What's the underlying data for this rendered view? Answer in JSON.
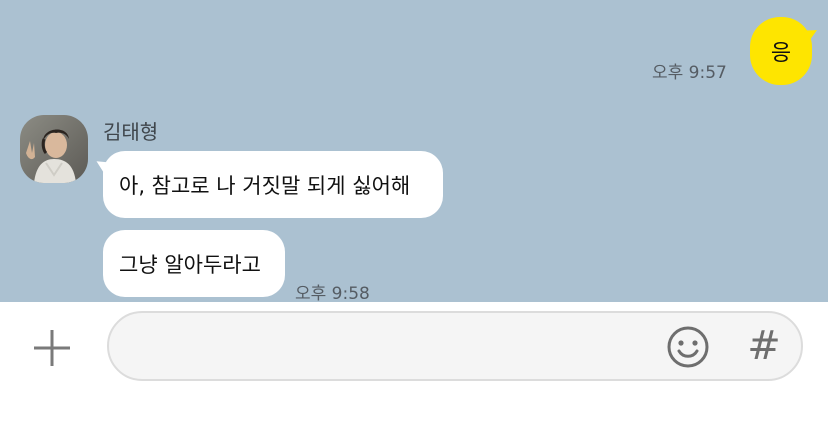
{
  "messages": {
    "mine": {
      "text": "응",
      "time": "오후 9:57"
    },
    "theirs": {
      "sender": "김태형",
      "bubbles": [
        "아, 참고로 나 거짓말 되게 싫어해",
        "그냥 알아두라고"
      ],
      "time": "오후 9:58"
    }
  },
  "input_bar": {
    "text_value": "",
    "icons": {
      "attach": "plus-icon",
      "emoji": "smiley-icon",
      "hashtag": "#"
    }
  },
  "colors": {
    "chat_background": "#abc1d1",
    "my_bubble": "#fee500",
    "their_bubble": "#ffffff"
  }
}
